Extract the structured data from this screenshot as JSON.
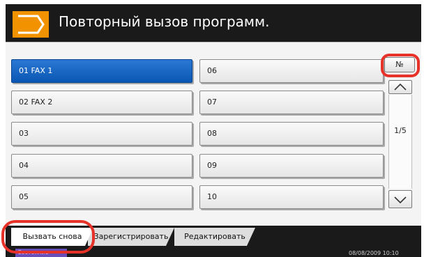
{
  "header": {
    "title": "Повторный вызов программ.",
    "icon": "program-arrow-icon",
    "accent_color": "#f39200"
  },
  "programs": [
    {
      "label": "01  FAX 1",
      "selected": true
    },
    {
      "label": "02  FAX 2",
      "selected": false
    },
    {
      "label": "03",
      "selected": false
    },
    {
      "label": "04",
      "selected": false
    },
    {
      "label": "05",
      "selected": false
    },
    {
      "label": "06",
      "selected": false
    },
    {
      "label": "07",
      "selected": false
    },
    {
      "label": "08",
      "selected": false
    },
    {
      "label": "09",
      "selected": false
    },
    {
      "label": "10",
      "selected": false
    }
  ],
  "side": {
    "number_button": "№",
    "page_indicator": "1/5",
    "up_icon": "chevron-up-icon",
    "down_icon": "chevron-down-icon"
  },
  "tabs": {
    "recall": "Вызвать снова",
    "register": "Зарегистрировать",
    "edit": "Редактировать"
  },
  "status": {
    "button": "Состояние",
    "datetime": "08/08/2009   10:10"
  },
  "colors": {
    "selected": "#0a56b4",
    "highlight_ring": "#e63228",
    "status_button": "#6a4fb8"
  }
}
